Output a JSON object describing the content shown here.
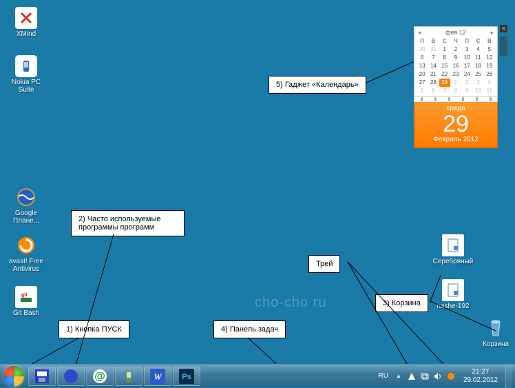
{
  "desktop_icons": {
    "xmind": "XMind",
    "nokia": "Nokia PC Suite",
    "google_earth": "Google Плане...",
    "avast": "avast! Free Antivirus",
    "gitbash": "Git Bash",
    "silver": "Серебряный",
    "nashe": "nashe-192",
    "recycle": "Корзина"
  },
  "callouts": {
    "start": "1) Кнопка ПУСК",
    "pinned": "2) Часто используемые\nпрограммы  программ",
    "recycle": "3) Корзина",
    "taskbar": "4) Панель задач",
    "gadget": "5) Гаджет «Календарь»",
    "tray": "Трей"
  },
  "watermark": "cho-cho ru",
  "calendar": {
    "month_short": "фев 12",
    "dow": [
      "П",
      "В",
      "С",
      "Ч",
      "П",
      "С",
      "В"
    ],
    "weeks": [
      [
        "30",
        "31",
        "1",
        "2",
        "3",
        "4",
        "5"
      ],
      [
        "6",
        "7",
        "8",
        "9",
        "10",
        "11",
        "12"
      ],
      [
        "13",
        "14",
        "15",
        "16",
        "17",
        "18",
        "19"
      ],
      [
        "20",
        "21",
        "22",
        "23",
        "24",
        "25",
        "26"
      ],
      [
        "27",
        "28",
        "29",
        "1",
        "2",
        "3",
        "4"
      ],
      [
        "5",
        "6",
        "7",
        "8",
        "9",
        "10",
        "11"
      ]
    ],
    "today_row": 4,
    "today_col": 2,
    "day_name": "среда",
    "day_num": "29",
    "month_full": "Февраль 2012"
  },
  "tray": {
    "lang": "RU",
    "time": "21:27",
    "date": "29.02.2012"
  }
}
